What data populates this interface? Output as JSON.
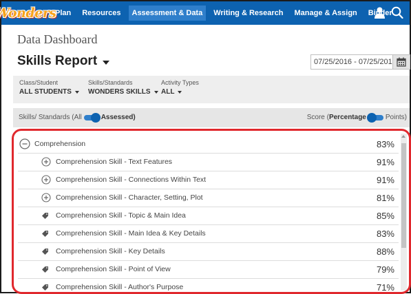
{
  "nav": {
    "logo": "Wonders",
    "items": [
      "Plan",
      "Resources",
      "Assessment & Data",
      "Writing & Research",
      "Manage & Assign",
      "Binder"
    ],
    "active_index": 2,
    "icons": [
      "user-icon",
      "search-icon"
    ]
  },
  "page": {
    "title": "Data Dashboard",
    "report_title": "Skills Report",
    "date_range": "07/25/2016 - 07/25/2017"
  },
  "filters": [
    {
      "label": "Class/Student",
      "value": "ALL STUDENTS"
    },
    {
      "label": "Skills/Standards",
      "value": "WONDERS SKILLS"
    },
    {
      "label": "Activity Types",
      "value": "ALL"
    }
  ],
  "toggles": {
    "skills_prefix": "Skills/ Standards (All",
    "skills_selected": "Assessed)",
    "score_prefix": "Score (",
    "score_selected": "Percentage",
    "score_other": "Points)"
  },
  "rows": [
    {
      "label": "Comprehension",
      "score": "83%",
      "icon": "minus-circle-icon",
      "level": 0
    },
    {
      "label": "Comprehension Skill - Text Features",
      "score": "91%",
      "icon": "plus-circle-icon",
      "level": 1
    },
    {
      "label": "Comprehension Skill - Connections Within Text",
      "score": "91%",
      "icon": "plus-circle-icon",
      "level": 1
    },
    {
      "label": "Comprehension Skill - Character, Setting, Plot",
      "score": "81%",
      "icon": "plus-circle-icon",
      "level": 1
    },
    {
      "label": "Comprehension Skill - Topic & Main Idea",
      "score": "85%",
      "icon": "tag-icon",
      "level": 1
    },
    {
      "label": "Comprehension Skill - Main Idea & Key Details",
      "score": "83%",
      "icon": "tag-icon",
      "level": 1
    },
    {
      "label": "Comprehension Skill - Key Details",
      "score": "88%",
      "icon": "tag-icon",
      "level": 1
    },
    {
      "label": "Comprehension Skill - Point of View",
      "score": "79%",
      "icon": "tag-icon",
      "level": 1
    },
    {
      "label": "Comprehension Skill - Author's Purpose",
      "score": "71%",
      "icon": "tag-icon",
      "level": 1
    }
  ],
  "colors": {
    "nav_bg": "#0d62b0",
    "nav_active": "#2f7fcb",
    "highlight_border": "#e0282d",
    "logo": "#f7a21b"
  }
}
